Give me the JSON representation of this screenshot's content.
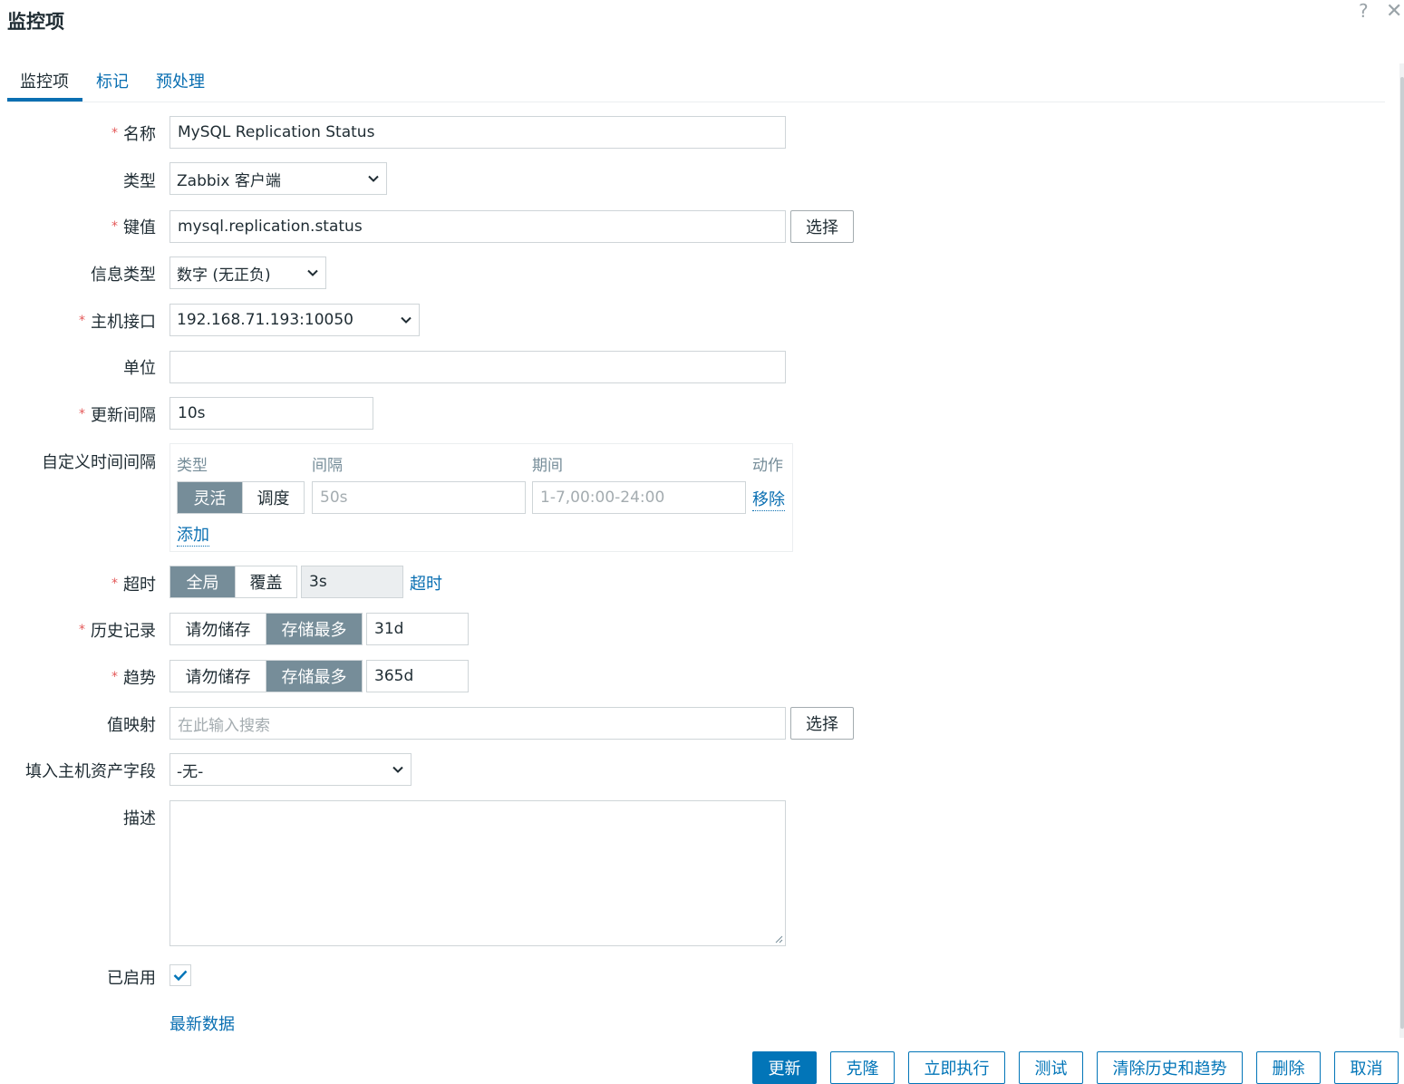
{
  "dialog": {
    "title": "监控项",
    "help_icon": "question-icon",
    "close_icon": "close-icon"
  },
  "tabs": [
    {
      "label": "监控项",
      "active": true
    },
    {
      "label": "标记",
      "active": false
    },
    {
      "label": "预处理",
      "active": false
    }
  ],
  "form": {
    "name": {
      "label": "名称",
      "value": "MySQL Replication Status"
    },
    "type": {
      "label": "类型",
      "value": "Zabbix 客户端"
    },
    "key": {
      "label": "键值",
      "value": "mysql.replication.status",
      "button": "选择"
    },
    "info_type": {
      "label": "信息类型",
      "value": "数字 (无正负)"
    },
    "interface": {
      "label": "主机接口",
      "value": "192.168.71.193:10050"
    },
    "units": {
      "label": "单位",
      "value": ""
    },
    "update_interval": {
      "label": "更新间隔",
      "value": "10s"
    },
    "custom_intervals": {
      "label": "自定义时间间隔",
      "columns": [
        "类型",
        "间隔",
        "期间",
        "动作"
      ],
      "row": {
        "type_options": [
          "灵活",
          "调度"
        ],
        "type_selected": "灵活",
        "interval_placeholder": "50s",
        "period_placeholder": "1-7,00:00-24:00",
        "remove": "移除"
      },
      "add": "添加"
    },
    "timeout": {
      "label": "超时",
      "options": [
        "全局",
        "覆盖"
      ],
      "selected": "全局",
      "value": "3s",
      "link": "超时"
    },
    "history": {
      "label": "历史记录",
      "options": [
        "请勿储存",
        "存储最多"
      ],
      "selected": "存储最多",
      "value": "31d"
    },
    "trends": {
      "label": "趋势",
      "options": [
        "请勿储存",
        "存储最多"
      ],
      "selected": "存储最多",
      "value": "365d"
    },
    "value_map": {
      "label": "值映射",
      "placeholder": "在此输入搜索",
      "button": "选择"
    },
    "inventory": {
      "label": "填入主机资产字段",
      "value": "-无-"
    },
    "description": {
      "label": "描述",
      "value": ""
    },
    "enabled": {
      "label": "已启用",
      "checked": true
    },
    "latest_data": "最新数据"
  },
  "footer_buttons": [
    "更新",
    "克隆",
    "立即执行",
    "测试",
    "清除历史和趋势",
    "删除",
    "取消"
  ],
  "colors": {
    "accent": "#0275b8",
    "segment_on": "#768d99",
    "required": "#e45959"
  }
}
